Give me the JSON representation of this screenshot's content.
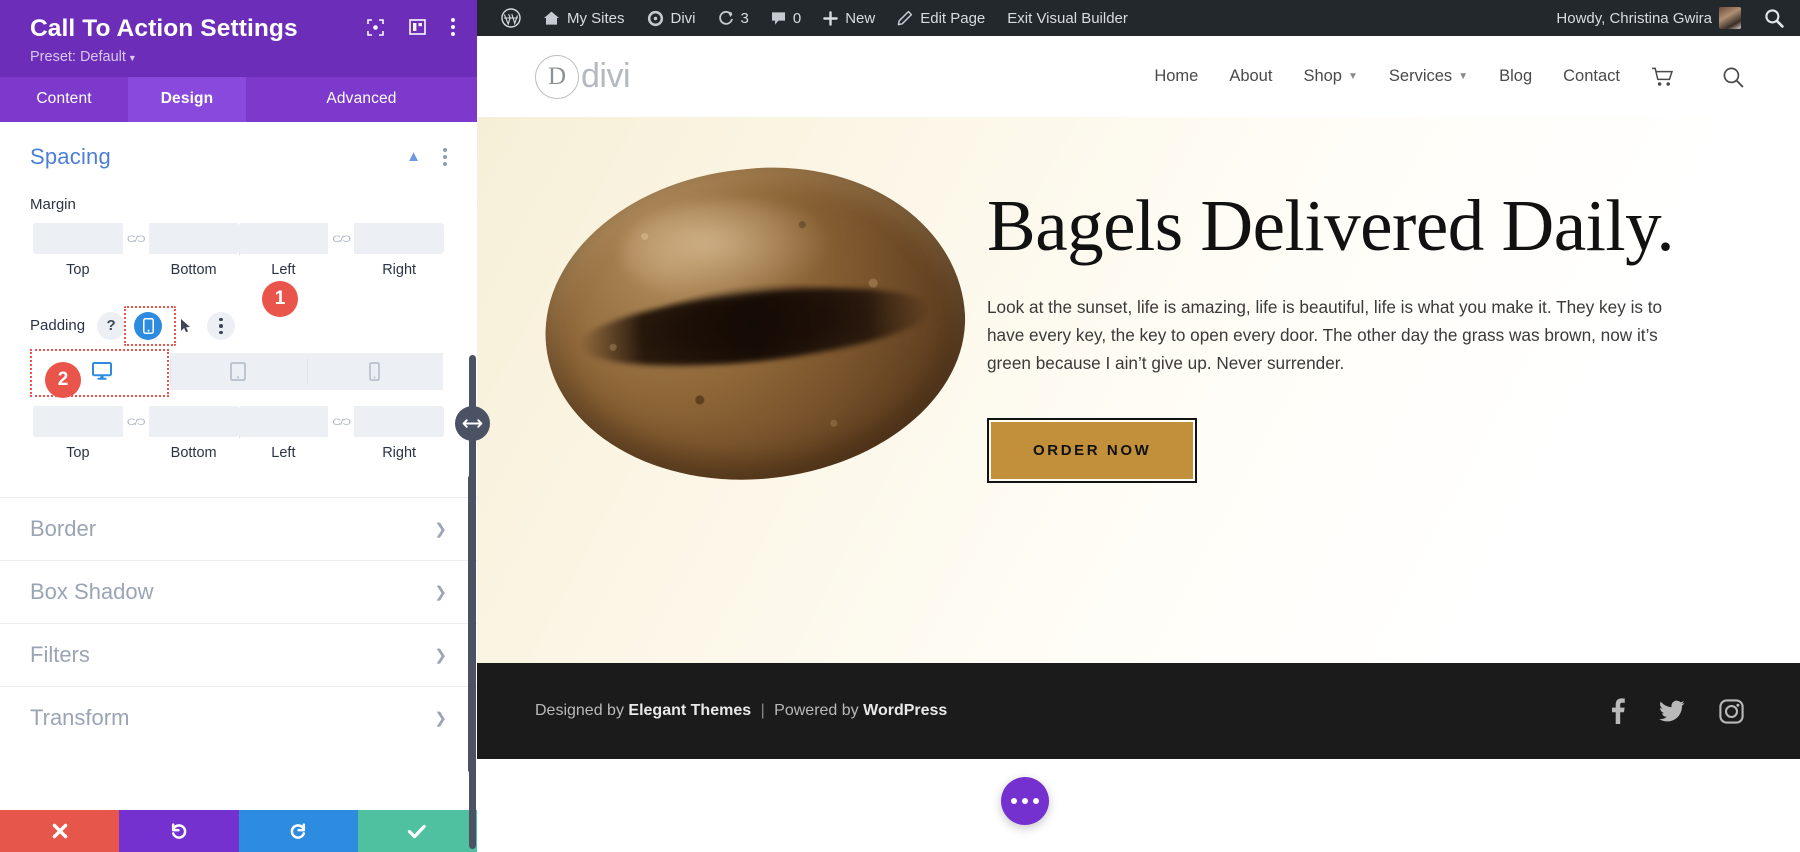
{
  "panel": {
    "title": "Call To Action Settings",
    "preset_label": "Preset: Default",
    "head_icons": [
      "target-icon",
      "layout-icon",
      "more-vertical-icon"
    ],
    "tabs": [
      {
        "label": "Content",
        "active": false
      },
      {
        "label": "Design",
        "active": true
      },
      {
        "label": "Advanced",
        "active": false
      }
    ],
    "spacing": {
      "title": "Spacing",
      "margin_label": "Margin",
      "padding_label": "Padding",
      "margin_fields": [
        {
          "caption": "Top",
          "value": ""
        },
        {
          "caption": "Bottom",
          "value": ""
        },
        {
          "caption": "Left",
          "value": ""
        },
        {
          "caption": "Right",
          "value": ""
        }
      ],
      "padding_fields": [
        {
          "caption": "Top",
          "value": ""
        },
        {
          "caption": "Bottom",
          "value": ""
        },
        {
          "caption": "Left",
          "value": ""
        },
        {
          "caption": "Right",
          "value": ""
        }
      ],
      "help_label": "?",
      "device_tabs": [
        {
          "icon": "desktop-icon",
          "active": true
        },
        {
          "icon": "tablet-icon",
          "active": false
        },
        {
          "icon": "phone-icon",
          "active": false
        }
      ],
      "annotations": [
        {
          "number": "1",
          "target": "responsive-toggle-icon"
        },
        {
          "number": "2",
          "target": "device-tab-desktop"
        }
      ]
    },
    "accordions": [
      {
        "label": "Border"
      },
      {
        "label": "Box Shadow"
      },
      {
        "label": "Filters"
      },
      {
        "label": "Transform"
      }
    ],
    "footer_buttons": [
      {
        "name": "discard",
        "icon": "close-icon",
        "color": "#e6564b"
      },
      {
        "name": "undo",
        "icon": "undo-icon",
        "color": "#7431d0"
      },
      {
        "name": "redo",
        "icon": "redo-icon",
        "color": "#2d8ce0"
      },
      {
        "name": "save",
        "icon": "check-icon",
        "color": "#4fc0a0"
      }
    ],
    "colors": {
      "header_purple": "#6c2eb9",
      "tab_purple": "#7c39cc",
      "active_tab_purple": "#8a49dd",
      "section_blue": "#4c7ed9",
      "annotation_red": "#e9554a",
      "active_device_blue": "#2d8ce0"
    }
  },
  "admin_bar": {
    "items": [
      {
        "icon": "wordpress-icon",
        "label": ""
      },
      {
        "icon": "sites-icon",
        "label": "My Sites"
      },
      {
        "icon": "divi-icon",
        "label": "Divi"
      },
      {
        "icon": "updates-icon",
        "label": "3"
      },
      {
        "icon": "comments-icon",
        "label": "0"
      },
      {
        "icon": "plus-icon",
        "label": "New"
      },
      {
        "icon": "pencil-icon",
        "label": "Edit Page"
      },
      {
        "icon": "",
        "label": "Exit Visual Builder"
      }
    ],
    "howdy": "Howdy, Christina Gwira",
    "search_icon": "search-icon"
  },
  "site": {
    "logo": {
      "mark": "D",
      "word": "divi"
    },
    "nav": [
      {
        "label": "Home",
        "has_dropdown": false
      },
      {
        "label": "About",
        "has_dropdown": false
      },
      {
        "label": "Shop",
        "has_dropdown": true
      },
      {
        "label": "Services",
        "has_dropdown": true
      },
      {
        "label": "Blog",
        "has_dropdown": false
      },
      {
        "label": "Contact",
        "has_dropdown": false
      }
    ],
    "nav_icons": [
      "cart-icon",
      "search-icon"
    ],
    "hero": {
      "heading": "Bagels Delivered Daily.",
      "paragraph": "Look at the sunset, life is amazing, life is beautiful, life is what you make it. They key is to have every key, the key to open every door. The other day the grass was brown, now it’s green because I ain’t give up. Never surrender.",
      "cta_label": "ORDER NOW",
      "cta_color": "#c2903a",
      "image_alt": "bagel-image"
    },
    "footer": {
      "designed_by": "Designed by",
      "designer": "Elegant Themes",
      "separator": "|",
      "powered_by": "Powered by",
      "platform": "WordPress",
      "socials": [
        "facebook-icon",
        "twitter-icon",
        "instagram-icon"
      ]
    },
    "fab": {
      "icon": "more-horizontal-icon",
      "color": "#7431d0"
    }
  }
}
